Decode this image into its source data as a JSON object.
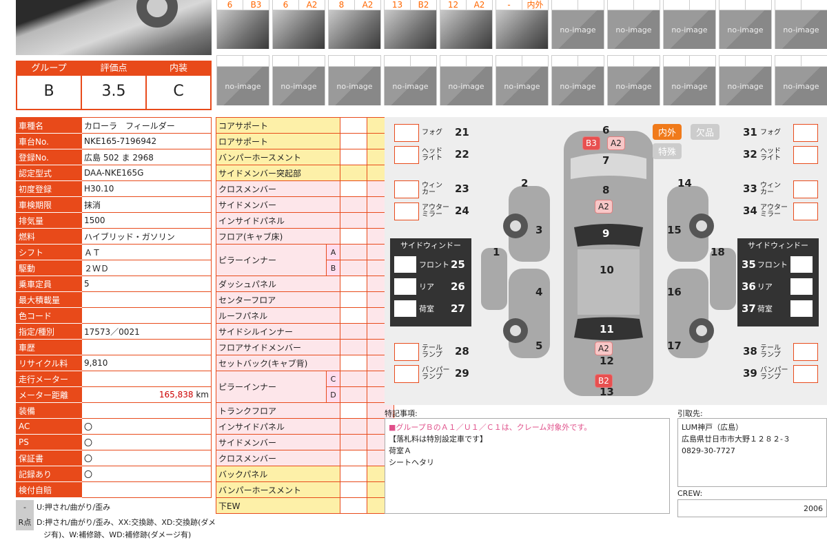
{
  "photos_top": [
    {
      "a": "6",
      "b": "B3",
      "kind": "photo"
    },
    {
      "a": "6",
      "b": "A2",
      "kind": "photo"
    },
    {
      "a": "8",
      "b": "A2",
      "kind": "photo"
    },
    {
      "a": "13",
      "b": "B2",
      "kind": "photo"
    },
    {
      "a": "12",
      "b": "A2",
      "kind": "photo"
    },
    {
      "a": "-",
      "b": "内外",
      "kind": "photo"
    },
    {
      "a": "",
      "b": "",
      "kind": "noimg"
    },
    {
      "a": "",
      "b": "",
      "kind": "noimg"
    },
    {
      "a": "",
      "b": "",
      "kind": "noimg"
    },
    {
      "a": "",
      "b": "",
      "kind": "noimg"
    },
    {
      "a": "",
      "b": "",
      "kind": "noimg"
    }
  ],
  "noimage_label": "no-image",
  "grades": [
    {
      "label": "グループ",
      "value": "B"
    },
    {
      "label": "評価点",
      "value": "3.5"
    },
    {
      "label": "内装",
      "value": "C"
    }
  ],
  "spec": [
    [
      "車種名",
      "カローラ　フィールダー"
    ],
    [
      "車台No.",
      "NKE165-7196942"
    ],
    [
      "登録No.",
      "広島 502 ま 2968"
    ],
    [
      "認定型式",
      "DAA-NKE165G"
    ],
    [
      "初度登録",
      "H30.10"
    ],
    [
      "車検期限",
      "抹消"
    ],
    [
      "排気量",
      "1500"
    ],
    [
      "燃料",
      "ハイブリッド・ガソリン"
    ],
    [
      "シフト",
      "ＡＴ"
    ],
    [
      "駆動",
      "２ＷＤ"
    ],
    [
      "乗車定員",
      "5"
    ],
    [
      "最大積載量",
      ""
    ],
    [
      "色コード",
      ""
    ],
    [
      "指定/種別",
      "17573／0021"
    ],
    [
      "車歴",
      ""
    ],
    [
      "リサイクル料",
      "9,810"
    ],
    [
      "走行メーター",
      ""
    ],
    [
      "メーター距離",
      "165,838"
    ],
    [
      "装備",
      ""
    ],
    [
      "AC",
      "〇"
    ],
    [
      "PS",
      "〇"
    ],
    [
      "保証書",
      "〇"
    ],
    [
      "記録あり",
      "〇"
    ],
    [
      "検付自賠",
      ""
    ]
  ],
  "km_unit": "km",
  "parts": [
    {
      "n": "コアサポート",
      "c": "y",
      "sub": "",
      "cells": 1
    },
    {
      "n": "ロアサポート",
      "c": "y",
      "sub": "",
      "cells": 1
    },
    {
      "n": "バンパーホースメント",
      "c": "y",
      "sub": "",
      "cells": 1
    },
    {
      "n": "サイドメンバー突起部",
      "c": "y",
      "sub": "",
      "cells": 2
    },
    {
      "n": "クロスメンバー",
      "c": "p",
      "sub": "",
      "cells": 1
    },
    {
      "n": "サイドメンバー",
      "c": "p",
      "sub": "",
      "cells": 2
    },
    {
      "n": "インサイドパネル",
      "c": "p",
      "sub": "",
      "cells": 2
    },
    {
      "n": "フロア(キャブ床)",
      "c": "p",
      "sub": "",
      "cells": 1
    },
    {
      "n": "ピラーインナー",
      "c": "p",
      "sub": "A",
      "cells": 2
    },
    {
      "n": "",
      "c": "p",
      "sub": "B",
      "cells": 2
    },
    {
      "n": "ダッシュパネル",
      "c": "p",
      "sub": "",
      "cells": 1
    },
    {
      "n": "センターフロア",
      "c": "p",
      "sub": "",
      "cells": 1
    },
    {
      "n": "ルーフパネル",
      "c": "p",
      "sub": "",
      "cells": 1
    },
    {
      "n": "サイドシルインナー",
      "c": "p",
      "sub": "",
      "cells": 2
    },
    {
      "n": "フロアサイドメンバー",
      "c": "p",
      "sub": "",
      "cells": 2
    },
    {
      "n": "セットバック(キャブ背)",
      "c": "p",
      "sub": "",
      "cells": 1
    },
    {
      "n": "ピラーインナー",
      "c": "p",
      "sub": "C",
      "cells": 2
    },
    {
      "n": "",
      "c": "p",
      "sub": "D",
      "cells": 2
    },
    {
      "n": "トランクフロア",
      "c": "p",
      "sub": "",
      "cells": 1
    },
    {
      "n": "インサイドパネル",
      "c": "p",
      "sub": "",
      "cells": 2
    },
    {
      "n": "サイドメンバー",
      "c": "p",
      "sub": "",
      "cells": 2
    },
    {
      "n": "クロスメンバー",
      "c": "p",
      "sub": "",
      "cells": 1
    },
    {
      "n": "バックパネル",
      "c": "y",
      "sub": "",
      "cells": 1
    },
    {
      "n": "バンパーホースメント",
      "c": "y",
      "sub": "",
      "cells": 1
    },
    {
      "n": "下EW",
      "c": "y",
      "sub": "",
      "cells": 1
    }
  ],
  "diagram": {
    "tag_inout": "内外",
    "tag_missing": "欠品",
    "tag_special": "特殊",
    "left": [
      {
        "l": "フォグ",
        "n": "21"
      },
      {
        "l": "ヘッド\nライト",
        "n": "22"
      },
      {
        "l": "ウィン\nカー",
        "n": "23"
      },
      {
        "l": "アウター\nミラー",
        "n": "24"
      },
      {
        "l": "テール\nランプ",
        "n": "28"
      },
      {
        "l": "バンパー\nランプ",
        "n": "29"
      }
    ],
    "right": [
      {
        "l": "フォグ",
        "n": "31"
      },
      {
        "l": "ヘッド\nライト",
        "n": "32"
      },
      {
        "l": "ウィン\nカー",
        "n": "33"
      },
      {
        "l": "アウター\nミラー",
        "n": "34"
      },
      {
        "l": "テール\nランプ",
        "n": "38"
      },
      {
        "l": "バンパー\nランプ",
        "n": "39"
      }
    ],
    "side_title": "サイドウィンドー",
    "side_left": [
      {
        "l": "フロント",
        "n": "25"
      },
      {
        "l": "リア",
        "n": "26"
      },
      {
        "l": "荷室",
        "n": "27"
      }
    ],
    "side_right": [
      {
        "n": "35",
        "l": "フロント"
      },
      {
        "n": "36",
        "l": "リア"
      },
      {
        "n": "37",
        "l": "荷室"
      }
    ],
    "car_numbers": [
      "6",
      "7",
      "8",
      "9",
      "10",
      "11",
      "12",
      "13",
      "1",
      "2",
      "3",
      "4",
      "5",
      "14",
      "15",
      "16",
      "17",
      "18"
    ],
    "chips": {
      "c6a": "B3",
      "c6b": "A2",
      "c8": "A2",
      "c12": "A2",
      "c13": "B2"
    }
  },
  "notes": {
    "title": "特記事項:",
    "line1": "■グループＢのＡ１／Ｕ１／Ｃ１は、クレーム対象外です。",
    "line2": "【落札料は特別設定車です】",
    "line3": "荷室Ａ",
    "line4": "シートヘタリ"
  },
  "pickup": {
    "title": "引取先:",
    "line1": "LUM神戸（広島）",
    "line2": "広島県廿日市市大野１２８２-３",
    "line3": "0829-30-7727"
  },
  "crew": {
    "title": "CREW:",
    "value": "2006"
  },
  "legend": [
    {
      "k": "-",
      "v": "U:押され/曲がり/歪み"
    },
    {
      "k": "R点",
      "v": "D:押され/曲がり/歪み、XX:交換跡、XD:交換跡(ダメ"
    }
  ],
  "legend_cont": "ジ有)、W:補修跡、WD:補修跡(ダメージ有)"
}
